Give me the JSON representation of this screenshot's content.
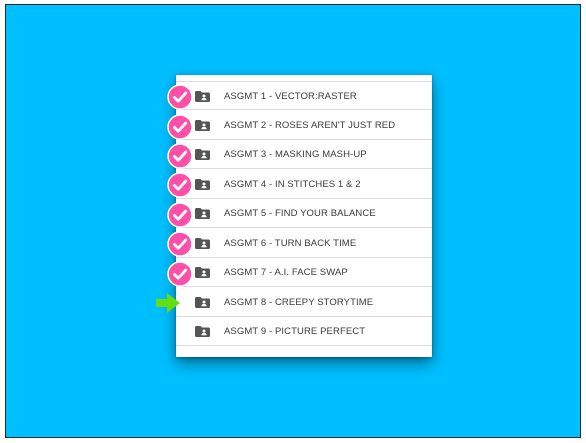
{
  "assignments": [
    {
      "label": "ASGMT 1 - VECTOR:RASTER",
      "completed": true,
      "current": false
    },
    {
      "label": "ASGMT 2 - ROSES AREN'T JUST RED",
      "completed": true,
      "current": false
    },
    {
      "label": "ASGMT 3 - MASKING MASH-UP",
      "completed": true,
      "current": false
    },
    {
      "label": "ASGMT 4 - IN STITCHES 1 & 2",
      "completed": true,
      "current": false
    },
    {
      "label": "ASGMT 5 - FIND YOUR BALANCE",
      "completed": true,
      "current": false
    },
    {
      "label": "ASGMT 6 - TURN BACK TIME",
      "completed": true,
      "current": false
    },
    {
      "label": "ASGMT 7 - A.I. FACE SWAP",
      "completed": true,
      "current": false
    },
    {
      "label": "ASGMT 8 - CREEPY STORYTIME",
      "completed": false,
      "current": true
    },
    {
      "label": "ASGMT 9 - PICTURE PERFECT",
      "completed": false,
      "current": false
    }
  ],
  "icons": {
    "row_icon": "shared-folder-icon",
    "completed_marker": "check-circle-icon",
    "current_marker": "arrow-right-icon"
  },
  "colors": {
    "background": "#00bfff",
    "check": "#ff4fa8",
    "arrow": "#66dd11",
    "folder": "#555555"
  }
}
